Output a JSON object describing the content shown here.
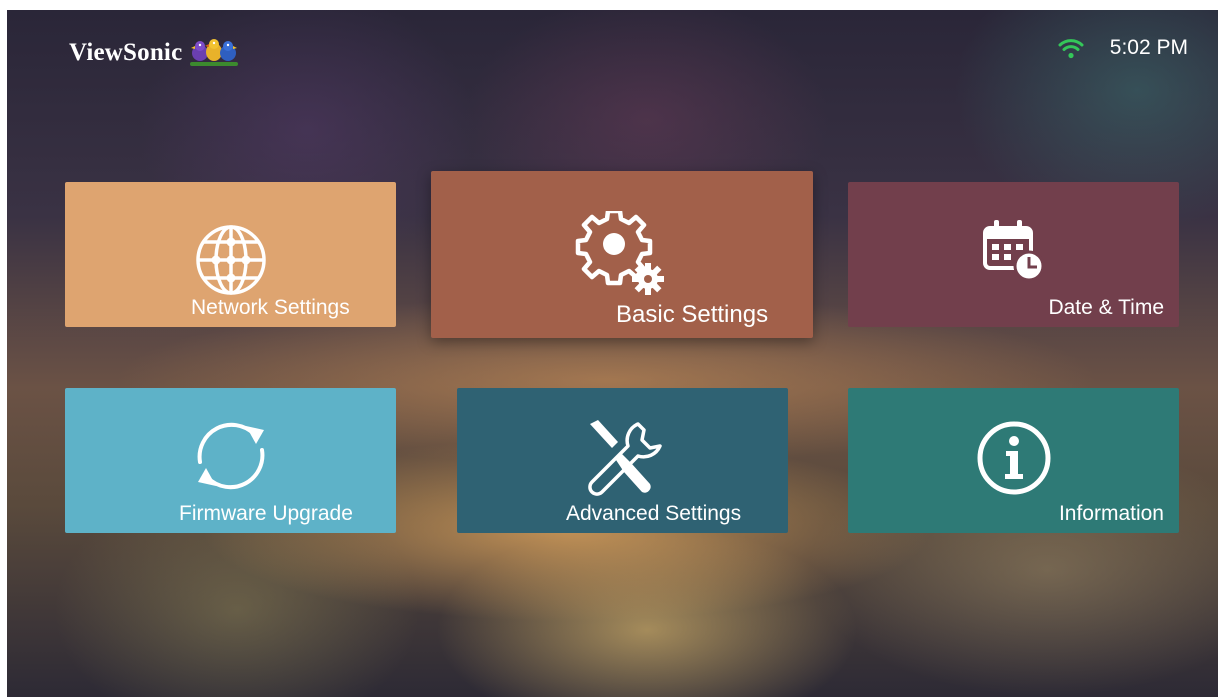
{
  "brand": {
    "name": "ViewSonic",
    "logo_icon": "birds-logo-icon"
  },
  "status_bar": {
    "wifi_icon": "wifi-icon",
    "time": "5:02 PM",
    "wifi_color": "#34c759"
  },
  "tiles": [
    {
      "label": "Network Settings",
      "icon": "globe-network-icon",
      "color": "#dea470"
    },
    {
      "label": "Basic Settings",
      "icon": "gears-icon",
      "color": "#a2604a",
      "selected": true
    },
    {
      "label": "Date & Time",
      "icon": "calendar-clock-icon",
      "color": "#723f4c"
    },
    {
      "label": "Firmware Upgrade",
      "icon": "refresh-arrows-icon",
      "color": "#5eb2c8"
    },
    {
      "label": "Advanced Settings",
      "icon": "tools-icon",
      "color": "#2f6273"
    },
    {
      "label": "Information",
      "icon": "info-icon",
      "color": "#2e7a76"
    }
  ]
}
